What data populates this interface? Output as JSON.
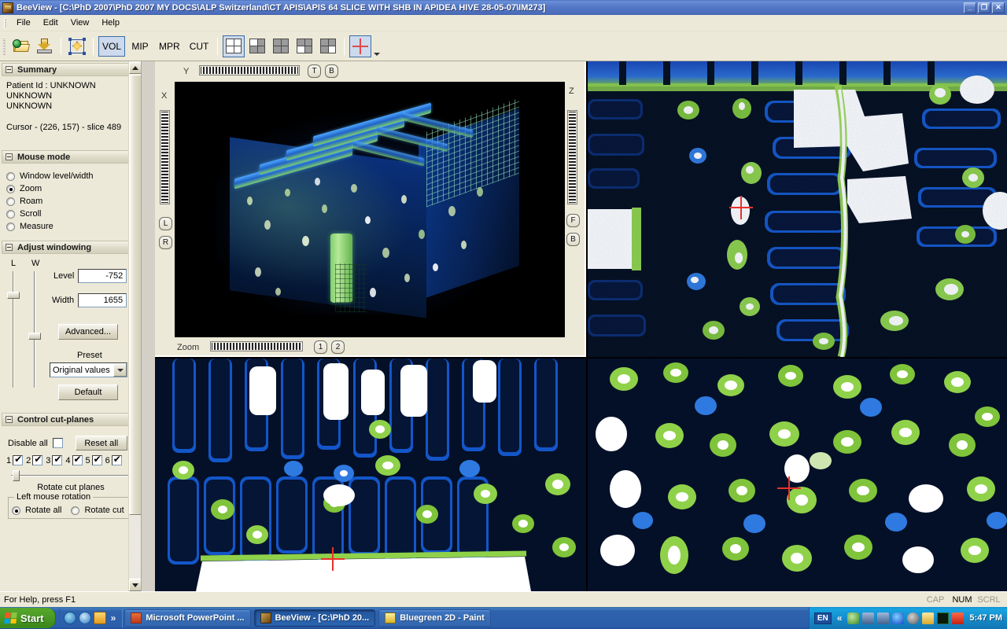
{
  "window": {
    "app_name": "BeeView",
    "title": "BeeView - [C:\\PhD 2007\\PhD 2007 MY DOCS\\ALP Switzerland\\CT APIS\\APIS 64 SLICE WITH SHB IN APIDEA HIVE 28-05-07\\IM273]",
    "minimize_label": "_",
    "restore_label": "❐",
    "close_label": "✕"
  },
  "menubar": {
    "items": [
      {
        "label": "File"
      },
      {
        "label": "Edit"
      },
      {
        "label": "View"
      },
      {
        "label": "Help"
      }
    ]
  },
  "toolbar": {
    "open_label": "open-folder",
    "save_label": "save-export",
    "pan_label": "pan-move",
    "modes": [
      {
        "label": "VOL",
        "selected": true
      },
      {
        "label": "MIP",
        "selected": false
      },
      {
        "label": "MPR",
        "selected": false
      },
      {
        "label": "CUT",
        "selected": false
      }
    ],
    "layouts": [
      {
        "name": "layout-2x2-all",
        "selected": true
      },
      {
        "name": "layout-top-left",
        "selected": false
      },
      {
        "name": "layout-top-row",
        "selected": false
      },
      {
        "name": "layout-bottom-left",
        "selected": false
      },
      {
        "name": "layout-bottom-right",
        "selected": false
      }
    ],
    "crosshair": {
      "name": "crosshair-toggle",
      "selected": true
    }
  },
  "sidebar": {
    "summary": {
      "header": "Summary",
      "patient_id": "Patient Id : UNKNOWN",
      "line2": "UNKNOWN",
      "line3": "UNKNOWN",
      "cursor": "Cursor - (226, 157) - slice 489"
    },
    "mouse_mode": {
      "header": "Mouse mode",
      "options": [
        {
          "label": "Window level/width",
          "selected": false
        },
        {
          "label": "Zoom",
          "selected": true
        },
        {
          "label": "Roam",
          "selected": false
        },
        {
          "label": "Scroll",
          "selected": false
        },
        {
          "label": "Measure",
          "selected": false
        }
      ]
    },
    "adjust_windowing": {
      "header": "Adjust windowing",
      "slider_l_label": "L",
      "slider_w_label": "W",
      "level_label": "Level",
      "level_value": "-752",
      "width_label": "Width",
      "width_value": "1655",
      "advanced_label": "Advanced...",
      "preset_label": "Preset",
      "preset_value": "Original values",
      "default_label": "Default"
    },
    "control_cut_planes": {
      "header": "Control cut-planes",
      "disable_all_label": "Disable all",
      "disable_all_checked": false,
      "reset_all_label": "Reset all",
      "planes": [
        {
          "label": "1",
          "checked": true
        },
        {
          "label": "2",
          "checked": true
        },
        {
          "label": "3",
          "checked": true
        },
        {
          "label": "4",
          "checked": true
        },
        {
          "label": "5",
          "checked": true
        },
        {
          "label": "6",
          "checked": true
        }
      ],
      "rotate_slider_label": "Rotate cut planes",
      "left_mouse_rotation_label": "Left mouse rotation",
      "rotate_options": [
        {
          "label": "Rotate all",
          "selected": true
        },
        {
          "label": "Rotate cut",
          "selected": false
        }
      ]
    }
  },
  "viewport_3d": {
    "axis_y_label": "Y",
    "axis_x_label": "X",
    "axis_z_label": "Z",
    "zoom_label": "Zoom",
    "buttons": [
      {
        "label": "T",
        "name": "top-view-button"
      },
      {
        "label": "B",
        "name": "bottom-view-button"
      },
      {
        "label": "L",
        "name": "left-view-button"
      },
      {
        "label": "R",
        "name": "right-view-button"
      },
      {
        "label": "F",
        "name": "front-view-button"
      },
      {
        "label": "B",
        "name": "back-view-button"
      },
      {
        "label": "1",
        "name": "preset-1-button"
      },
      {
        "label": "2",
        "name": "preset-2-button"
      }
    ]
  },
  "statusbar": {
    "message": "For Help, press F1",
    "indicators": [
      {
        "label": "CAP",
        "active": false
      },
      {
        "label": "NUM",
        "active": true
      },
      {
        "label": "SCRL",
        "active": false
      }
    ]
  },
  "taskbar": {
    "start_label": "Start",
    "chevron": "»",
    "tasks": [
      {
        "label": "Microsoft PowerPoint ...",
        "active": false,
        "icon_color": "#cf4a20"
      },
      {
        "label": "BeeView - [C:\\PhD 20...",
        "active": true,
        "icon_color": "#7b4a1e"
      },
      {
        "label": "Bluegreen 2D - Paint",
        "active": false,
        "icon_color": "#e8d24a"
      }
    ],
    "tray": {
      "language": "EN",
      "chevron": "«",
      "clock": "5:47 PM"
    }
  },
  "colors": {
    "accent_blue": "#3a6ea5",
    "panel_bg": "#ece9d8",
    "crosshair_red": "#e8322a",
    "titlebar_blue": "#4a6cba"
  }
}
